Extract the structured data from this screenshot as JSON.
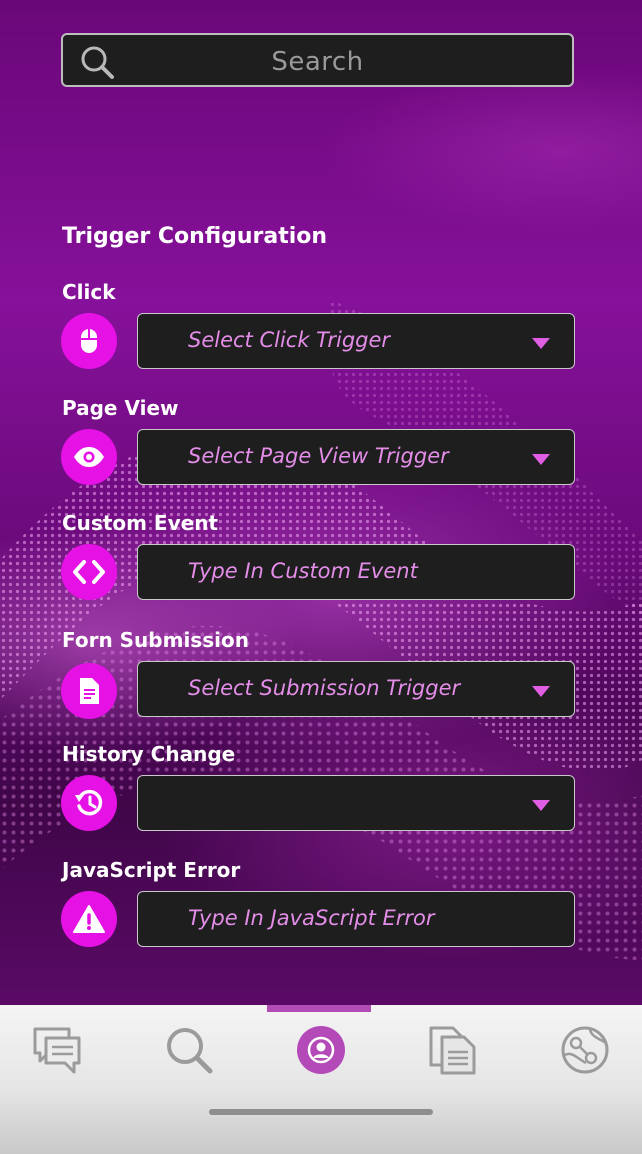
{
  "search": {
    "placeholder": "Search",
    "icon": "search-icon"
  },
  "section_title": "Trigger Configuration",
  "triggers": [
    {
      "label": "Click",
      "icon": "mouse-icon",
      "placeholder": "Select Click Trigger",
      "type": "dropdown"
    },
    {
      "label": "Page View",
      "icon": "eye-icon",
      "placeholder": "Select Page View Trigger",
      "type": "dropdown"
    },
    {
      "label": "Custom Event",
      "icon": "code-icon",
      "placeholder": "Type In Custom Event",
      "type": "text"
    },
    {
      "label": "Forn Submission",
      "icon": "document-icon",
      "placeholder": "Select Submission Trigger",
      "type": "dropdown"
    },
    {
      "label": "History Change",
      "icon": "history-icon",
      "placeholder": "",
      "type": "dropdown"
    },
    {
      "label": "JavaScript Error",
      "icon": "warning-icon",
      "placeholder": "Type In JavaScript Error",
      "type": "text"
    }
  ],
  "nav": {
    "items": [
      "chat-icon",
      "search-icon",
      "profile-icon",
      "documents-icon",
      "globe-icon"
    ],
    "active_index": 2
  },
  "colors": {
    "accent": "#e511e5",
    "field_bg": "#1e1e1e",
    "placeholder_text": "#e48de8",
    "nav_active": "#b44ab8"
  }
}
